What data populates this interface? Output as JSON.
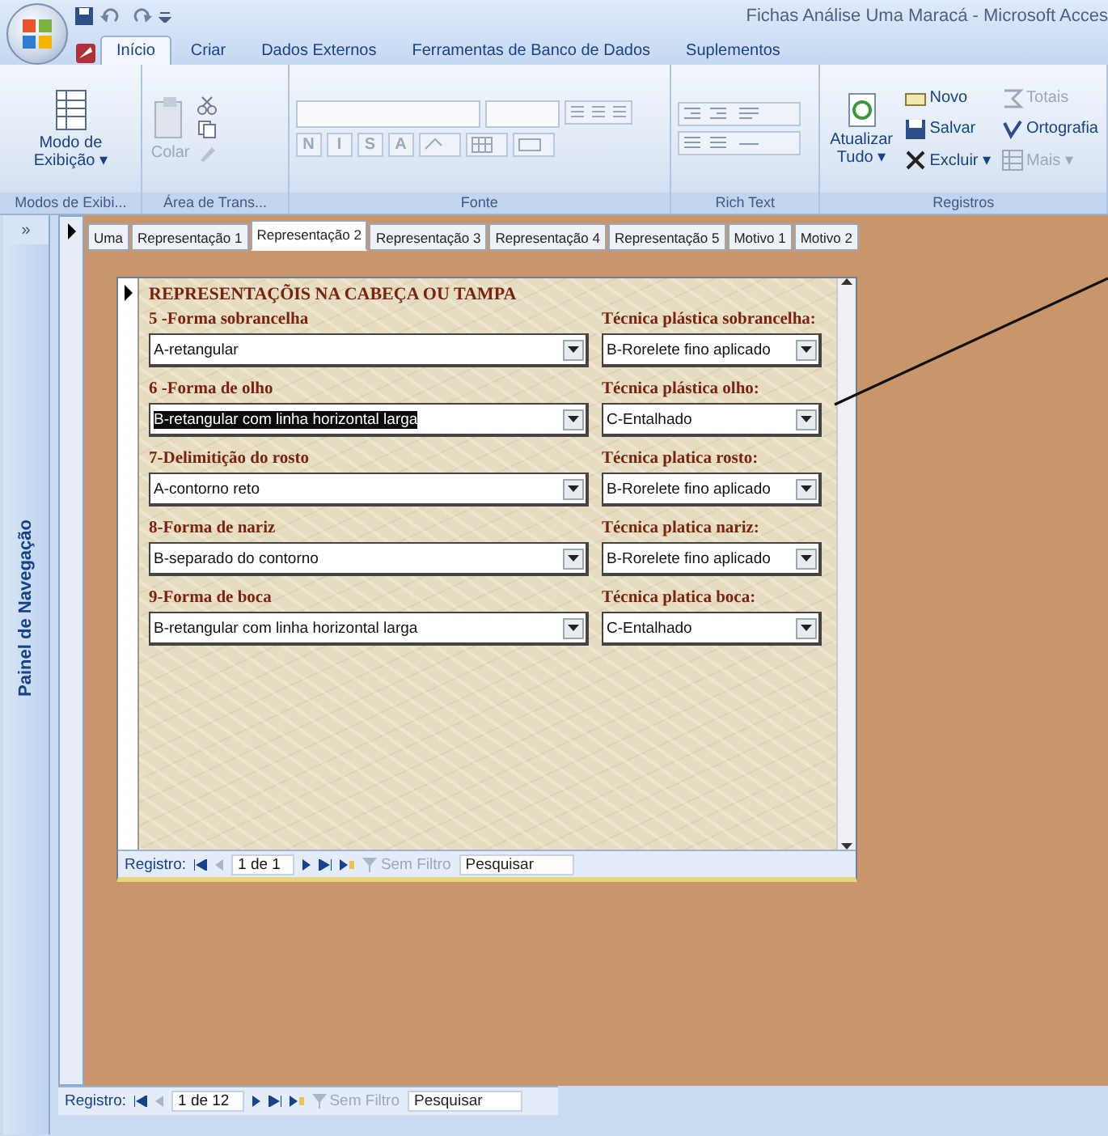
{
  "window": {
    "title": "Fichas Análise Uma Maracá - Microsoft Acces"
  },
  "ribbon_tabs": [
    {
      "label": "Início",
      "selected": true
    },
    {
      "label": "Criar",
      "selected": false
    },
    {
      "label": "Dados Externos",
      "selected": false
    },
    {
      "label": "Ferramentas de Banco de Dados",
      "selected": false
    },
    {
      "label": "Suplementos",
      "selected": false
    }
  ],
  "ribbon_groups": [
    {
      "kind": "views",
      "label": "Modos de Exibi...",
      "items": [
        {
          "label": "Modo de Exibição ▾",
          "disabled": false
        }
      ]
    },
    {
      "kind": "clipboard",
      "label": "Área de Trans...",
      "items": [
        {
          "label": "Colar",
          "disabled": true
        }
      ]
    },
    {
      "kind": "font",
      "label": "Fonte",
      "items": [
        {
          "label": "N",
          "disabled": true
        },
        {
          "label": "I",
          "disabled": true
        },
        {
          "label": "S",
          "disabled": true
        },
        {
          "label": "A",
          "disabled": true
        }
      ]
    },
    {
      "kind": "richtext",
      "label": "Rich Text"
    },
    {
      "kind": "records",
      "label": "Registros",
      "items": [
        {
          "label": "Atualizar Tudo ▾",
          "disabled": false
        },
        {
          "label": "Novo",
          "disabled": false
        },
        {
          "label": "Salvar",
          "disabled": false
        },
        {
          "label": "Excluir ▾",
          "disabled": false
        },
        {
          "label": "Totais",
          "disabled": true
        },
        {
          "label": "Ortografia",
          "disabled": false
        },
        {
          "label": "Mais ▾",
          "disabled": true
        }
      ]
    }
  ],
  "navigation_pane": {
    "title": "Painel de Navegação",
    "toggle": "»"
  },
  "form_tabs": [
    {
      "label": "Uma",
      "selected": false
    },
    {
      "label": "Representação 1",
      "selected": false
    },
    {
      "label": "Representação 2",
      "selected": true
    },
    {
      "label": "Representação 3",
      "selected": false
    },
    {
      "label": "Representação 4",
      "selected": false
    },
    {
      "label": "Representação 5",
      "selected": false
    },
    {
      "label": "Motivo 1",
      "selected": false
    },
    {
      "label": "Motivo 2",
      "selected": false
    }
  ],
  "subform": {
    "title": "REPRESENTAÇÕIS NA CABEÇA OU TAMPA",
    "rows": [
      {
        "left": {
          "label": "5 -Forma sobrancelha",
          "value": "A-retangular",
          "highlighted": false
        },
        "right": {
          "label": "Técnica plástica sobrancelha:",
          "value": "B-Rorelete fino aplicado"
        }
      },
      {
        "left": {
          "label": "6 -Forma de olho",
          "value": "B-retangular com linha horizontal larga",
          "highlighted": true
        },
        "right": {
          "label": "Técnica plástica olho:",
          "value": "C-Entalhado"
        }
      },
      {
        "left": {
          "label": "7-Delimitição do rosto",
          "value": "A-contorno reto",
          "highlighted": false
        },
        "right": {
          "label": "Técnica platica rosto:",
          "value": "B-Rorelete fino aplicado"
        }
      },
      {
        "left": {
          "label": "8-Forma de nariz",
          "value": "B-separado do contorno",
          "highlighted": false
        },
        "right": {
          "label": "Técnica platica nariz:",
          "value": "B-Rorelete fino aplicado"
        }
      },
      {
        "left": {
          "label": "9-Forma de boca",
          "value": "B-retangular com linha horizontal larga",
          "highlighted": false
        },
        "right": {
          "label": "Técnica platica boca:",
          "value": "C-Entalhado"
        }
      }
    ],
    "record_nav": {
      "label": "Registro:",
      "position": "1 de 1",
      "filter": "Sem Filtro",
      "search": "Pesquisar"
    }
  },
  "record_nav": {
    "label": "Registro:",
    "position": "1 de 12",
    "filter": "Sem Filtro",
    "search": "Pesquisar"
  }
}
